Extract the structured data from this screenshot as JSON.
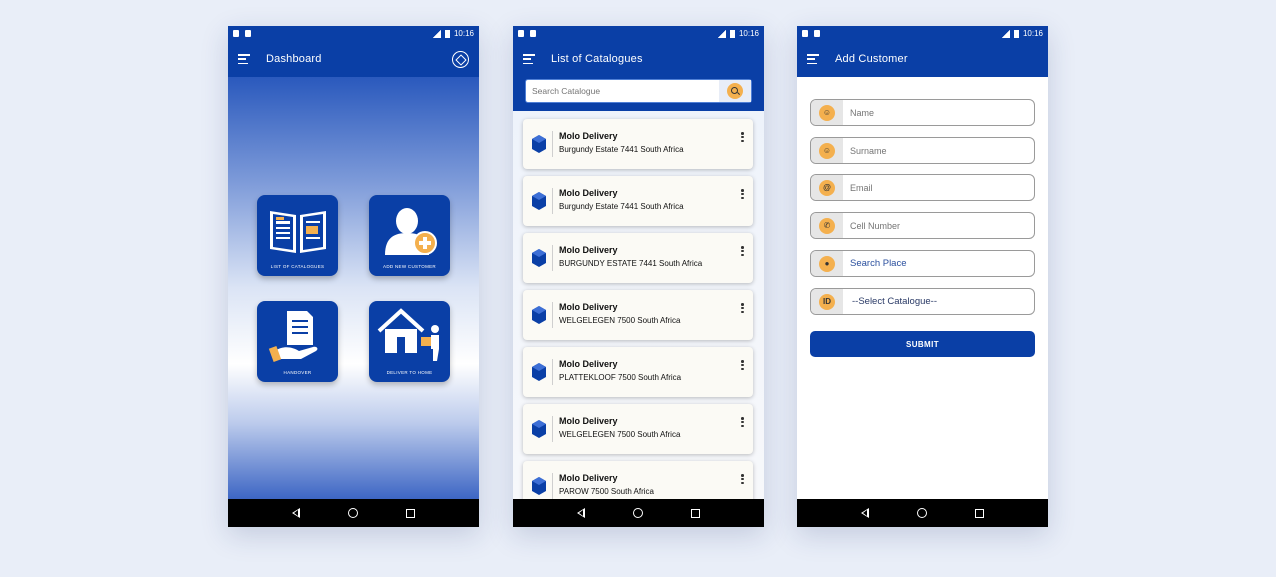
{
  "status": {
    "time": "10:16"
  },
  "dashboard": {
    "title": "Dashboard",
    "tiles": [
      {
        "label": "LIST OF CATALOGUES",
        "icon": "book-icon"
      },
      {
        "label": "ADD NEW CUSTOMER",
        "icon": "add-user-icon"
      },
      {
        "label": "HANDOVER",
        "icon": "handover-icon"
      },
      {
        "label": "DELIVER TO HOME",
        "icon": "deliver-home-icon"
      }
    ]
  },
  "catalogues": {
    "title": "List of Catalogues",
    "search_placeholder": "Search Catalogue",
    "items": [
      {
        "title": "Molo Delivery",
        "address": "Burgundy Estate 7441 South Africa"
      },
      {
        "title": "Molo Delivery",
        "address": "Burgundy Estate 7441 South Africa"
      },
      {
        "title": "Molo Delivery",
        "address": "BURGUNDY ESTATE 7441 South Africa"
      },
      {
        "title": "Molo Delivery",
        "address": "WELGELEGEN 7500 South Africa"
      },
      {
        "title": "Molo Delivery",
        "address": "PLATTEKLOOF 7500 South Africa"
      },
      {
        "title": "Molo Delivery",
        "address": "WELGELEGEN 7500 South Africa"
      },
      {
        "title": "Molo Delivery",
        "address": "PAROW 7500 South Africa"
      }
    ]
  },
  "customer": {
    "title": "Add Customer",
    "name_placeholder": "Name",
    "surname_placeholder": "Surname",
    "email_placeholder": "Email",
    "cell_placeholder": "Cell Number",
    "place_label": "Search Place",
    "catalogue_select": "--Select Catalogue--",
    "submit_label": "SUBMIT"
  },
  "colors": {
    "primary": "#0a3fa6",
    "accent": "#f4b04e"
  }
}
